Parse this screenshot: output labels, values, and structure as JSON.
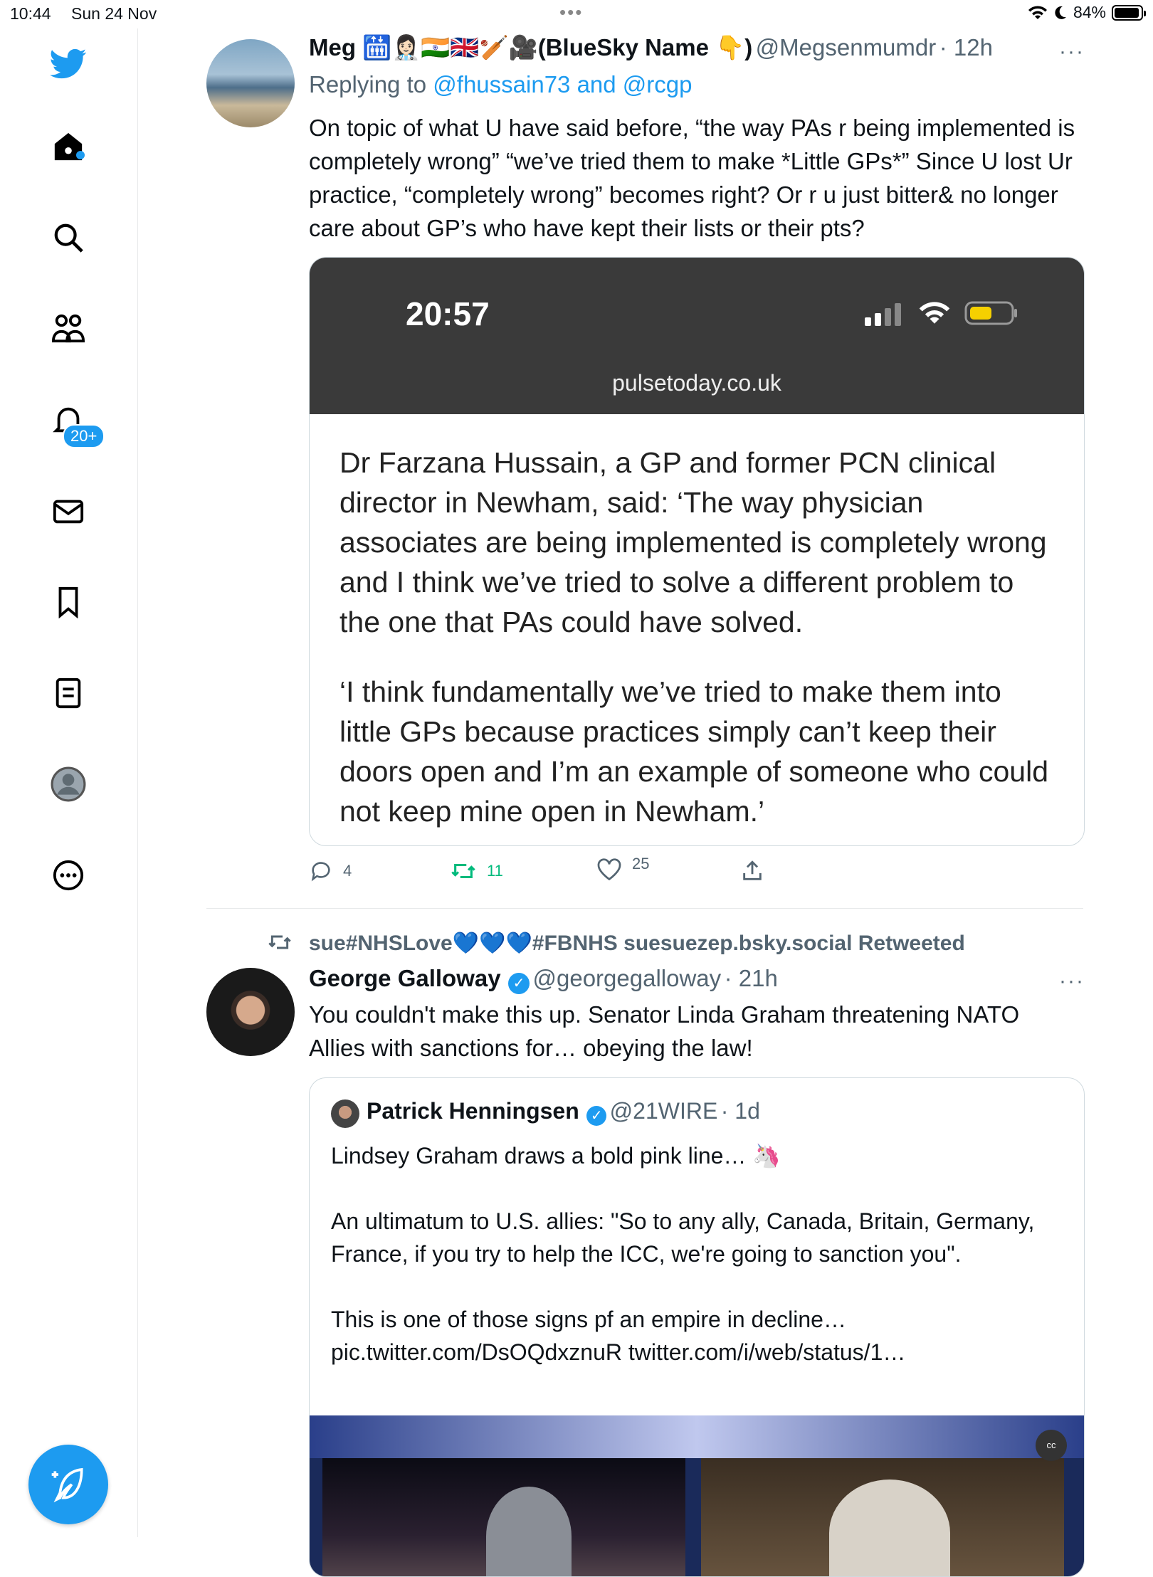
{
  "status_bar": {
    "time": "10:44",
    "date": "Sun 24 Nov",
    "battery": "84%"
  },
  "sidebar": {
    "notifications_badge": "20+"
  },
  "tweet1": {
    "name": "Meg 🛗👩🏻‍⚕️🇮🇳🇬🇧🏏🎥(BlueSky Name 👇)",
    "handle": "@Megsenmumdr",
    "time": "· 12h",
    "replying_prefix": "Replying to",
    "replying_to": "@fhussain73 and @rcgp",
    "text": "On topic of what U have said before, “the way PAs r being implemented is completely wrong” “we’ve tried them to make *Little GPs*” Since U lost Ur practice, “completely wrong” becomes right? Or r u just bitter& no longer care about GP’s who have kept their lists or their pts?",
    "image": {
      "clock": "20:57",
      "url": "pulsetoday.co.uk",
      "para1": "Dr Farzana Hussain, a GP and former PCN clinical director in Newham, said: ‘The way physician associates are being implemented is completely wrong and I think we’ve tried to solve a different problem to the one that PAs could have solved.",
      "para2": "‘I think fundamentally we’ve tried to make them into little GPs because practices simply can’t keep their doors open and I’m an example of someone who could not keep mine open in Newham.’"
    },
    "replies": "4",
    "retweets": "11",
    "likes": "25"
  },
  "tweet2": {
    "retweeted_by": "sue#NHSLove💙💙💙#FBNHS suesuezep.bsky.social Retweeted",
    "name": "George Galloway",
    "handle": "@georgegalloway",
    "time": "· 21h",
    "text": "You couldn't make this up. Senator Linda Graham threatening NATO Allies with sanctions for… obeying the law!",
    "quote": {
      "name": "Patrick Henningsen",
      "handle": "@21WIRE",
      "time": "· 1d",
      "para1": "Lindsey Graham draws a bold pink line… 🦄",
      "para2": "An ultimatum to U.S. allies: \"So to any ally, Canada, Britain, Germany, France, if you try to help the ICC, we're going to sanction you\".",
      "para3": "This is one of those signs pf an empire in decline…",
      "links": " pic.twitter.com/DsOQdxznuR twitter.com/i/web/status/1…",
      "cc_label": "cc"
    }
  },
  "colors": {
    "accent": "#1d9bf0",
    "retweet_green": "#00ba7c"
  }
}
